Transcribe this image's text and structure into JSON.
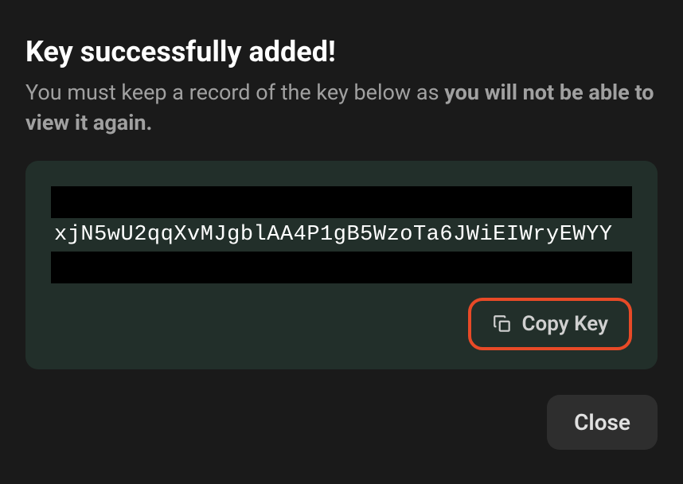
{
  "dialog": {
    "title": "Key successfully added!",
    "subtitle_prefix": "You must keep a record of the key below as ",
    "subtitle_bold": "you will not be able to view it again.",
    "key": "xjN5wU2qqXvMJgblAA4P1gB5WzoTa6JWiEIWryEWYY",
    "copy_label": "Copy Key",
    "close_label": "Close"
  }
}
